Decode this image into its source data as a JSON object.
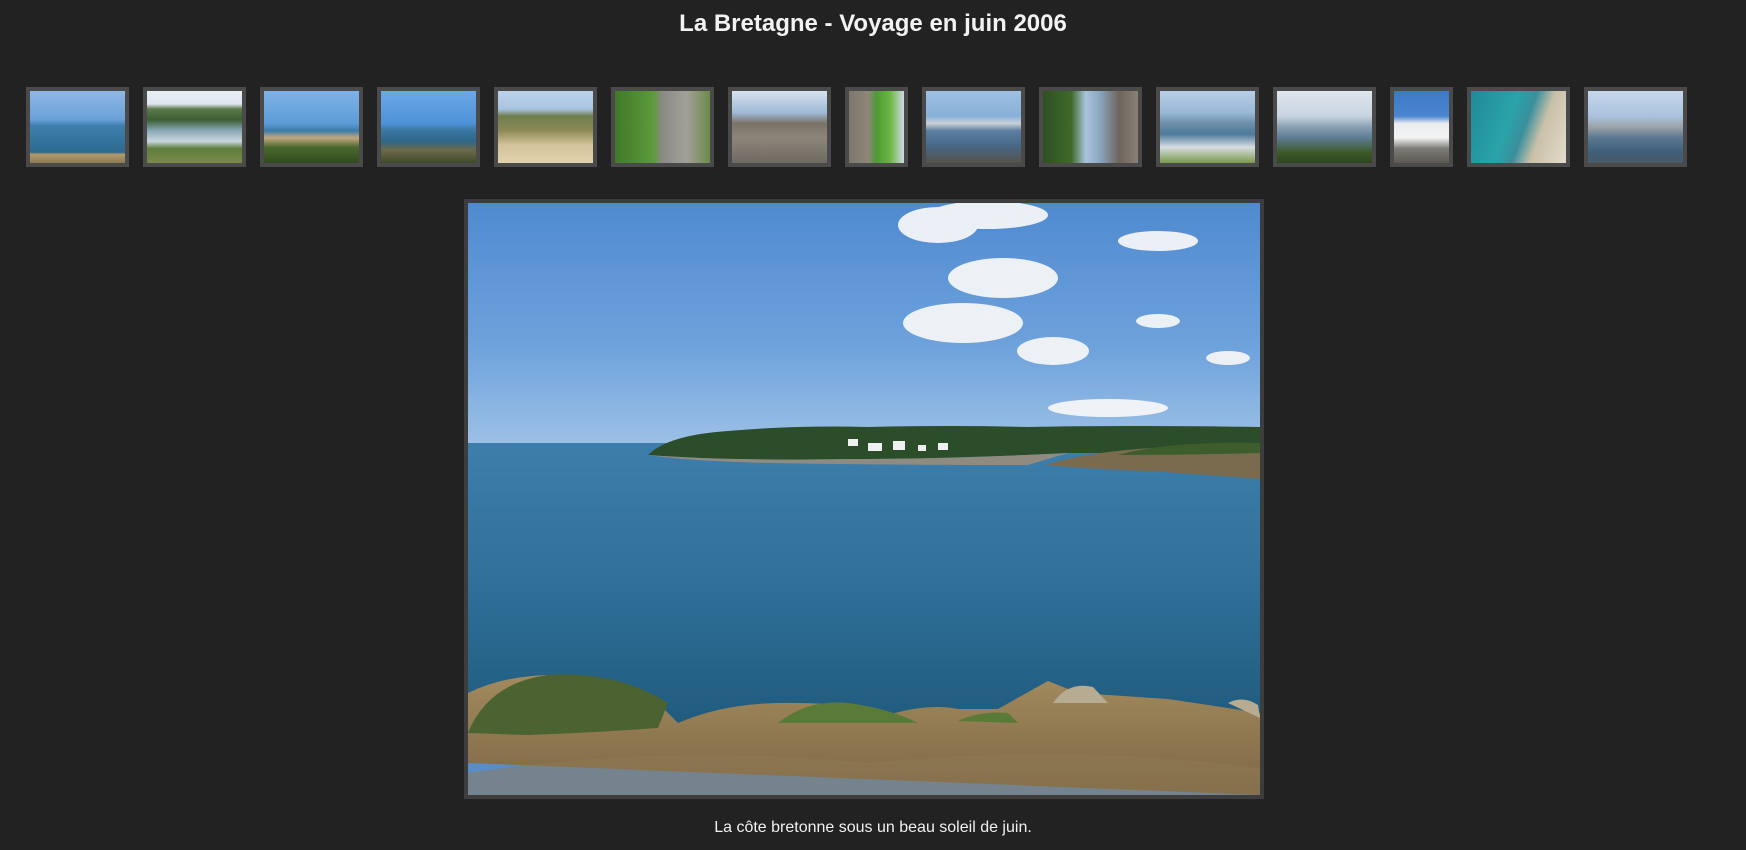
{
  "gallery": {
    "title": "La Bretagne - Voyage en juin 2006",
    "caption": "La côte bretonne sous un beau soleil de juin.",
    "thumbnails": [
      {
        "scene": "coastal-bay"
      },
      {
        "scene": "harbor-village"
      },
      {
        "scene": "rocky-coast-bushes"
      },
      {
        "scene": "sea-cliff"
      },
      {
        "scene": "sandy-path-dunes"
      },
      {
        "scene": "garden-stone-house"
      },
      {
        "scene": "ramparts-courtyard"
      },
      {
        "scene": "walled-garden-lawn"
      },
      {
        "scene": "marina"
      },
      {
        "scene": "canal-old-town"
      },
      {
        "scene": "seaside-promenade"
      },
      {
        "scene": "headland-view"
      },
      {
        "scene": "lighthouse-cyclist"
      },
      {
        "scene": "turquoise-cove"
      },
      {
        "scene": "harbor-boats"
      }
    ],
    "colors": {
      "background": "#222222",
      "frame": "#4a4a4a",
      "text": "#f2f2f2"
    }
  }
}
